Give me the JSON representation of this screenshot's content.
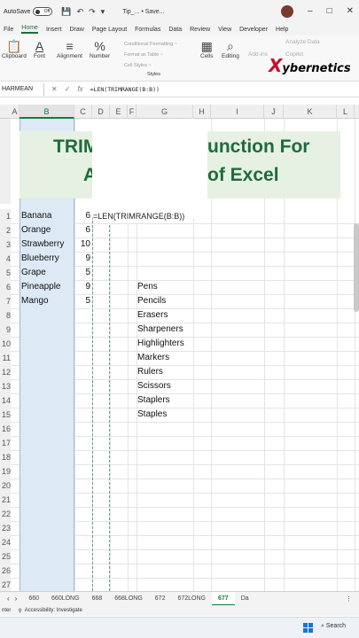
{
  "titlebar": {
    "autosave_label": "AutoSave",
    "autosave_state": "Off",
    "doc_title": "Tip_... • Save..."
  },
  "menu": [
    "File",
    "Home",
    "Insert",
    "Draw",
    "Page Layout",
    "Formulas",
    "Data",
    "Review",
    "View",
    "Developer",
    "Help"
  ],
  "ribbon": {
    "clipboard": "Clipboard",
    "font": "Font",
    "alignment": "Alignment",
    "number": "Number",
    "conditional": "Conditional Formatting ~",
    "format_table": "Format as Table ~",
    "cell_styles": "Cell Styles ~",
    "styles_label": "Styles",
    "cells": "Cells",
    "editing": "Editing",
    "addins": "Add-ins",
    "analyze": "Analyze Data",
    "copilot": "Copilot"
  },
  "logo": {
    "x": "X",
    "rest": "ybernetics"
  },
  "formula_bar": {
    "name_box": "HARMEAN",
    "formula": "=LEN(TRIMRANGE(B:B))"
  },
  "columns": [
    "A",
    "B",
    "C",
    "D",
    "E",
    "F",
    "G",
    "H",
    "I",
    "J",
    "K",
    "L"
  ],
  "rows": [
    "1",
    "2",
    "3",
    "4",
    "5",
    "6",
    "7",
    "8",
    "9",
    "10",
    "11",
    "12",
    "13",
    "14",
    "15",
    "16",
    "17",
    "18",
    "19",
    "20",
    "21",
    "22",
    "23",
    "24",
    "25",
    "26",
    "27"
  ],
  "banner": {
    "line1_left": "TRIM",
    "line1_right": "unction For",
    "line2_left": "A",
    "line2_right": "of Excel"
  },
  "fruits": [
    {
      "name": "Banana",
      "len": "6"
    },
    {
      "name": "Orange",
      "len": "6"
    },
    {
      "name": "Strawberry",
      "len": "10"
    },
    {
      "name": "Blueberry",
      "len": "9"
    },
    {
      "name": "Grape",
      "len": "5"
    },
    {
      "name": "Pineapple",
      "len": "9"
    },
    {
      "name": "Mango",
      "len": "5"
    }
  ],
  "formula_cell": "=LEN(TRIMRANGE(B:B))",
  "supplies": [
    "Pens",
    "Pencils",
    "Erasers",
    "Sharpeners",
    "Highlighters",
    "Markers",
    "Rulers",
    "Scissors",
    "Staplers",
    "Staples"
  ],
  "sheets": [
    "660",
    "660LONG",
    "668",
    "668LONG",
    "672",
    "672LONG",
    "677",
    "Da"
  ],
  "status": {
    "left": "nter",
    "accessibility": "Accessibility: Investigate"
  },
  "taskbar": {
    "search": "Search"
  }
}
